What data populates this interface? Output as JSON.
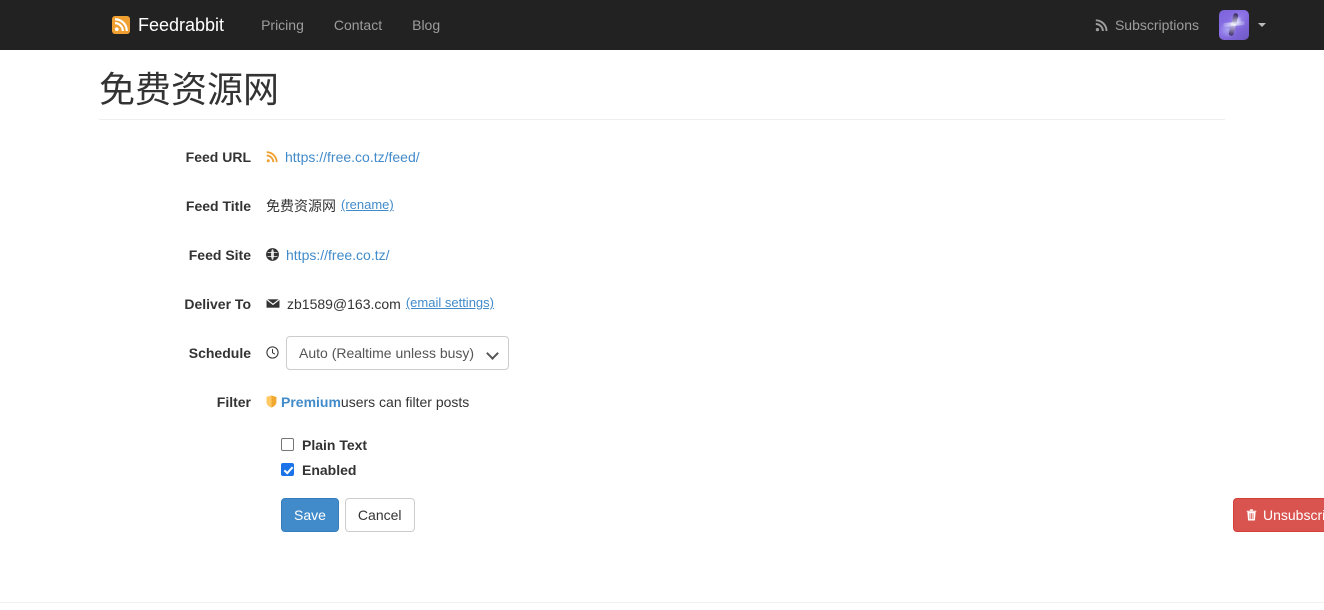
{
  "navbar": {
    "brand": {
      "label": "Feedrabbit",
      "icon": "rss-icon"
    },
    "links": [
      {
        "label": "Pricing",
        "name": "nav-link-pricing"
      },
      {
        "label": "Contact",
        "name": "nav-link-contact"
      },
      {
        "label": "Blog",
        "name": "nav-link-blog"
      }
    ],
    "subscriptions": {
      "label": "Subscriptions",
      "icon": "rss-icon"
    },
    "avatar": {
      "icon": "user-avatar",
      "caret": "caret-down-icon"
    },
    "background_color": "#222222",
    "link_color": "#9d9d9d"
  },
  "page": {
    "title": "免费资源网"
  },
  "form": {
    "feed_url": {
      "label": "Feed URL",
      "icon": "rss-icon",
      "value": "https://free.co.tz/feed/"
    },
    "feed_title": {
      "label": "Feed Title",
      "value": "免费资源网",
      "rename_link": "(rename)"
    },
    "feed_site": {
      "label": "Feed Site",
      "icon": "globe-icon",
      "value": "https://free.co.tz/"
    },
    "deliver_to": {
      "label": "Deliver To",
      "icon": "envelope-icon",
      "value": "zb1589@163.com",
      "settings_link": "(email settings)"
    },
    "schedule": {
      "label": "Schedule",
      "icon": "clock-icon",
      "selected": "Auto (Realtime unless busy)",
      "options": [
        "Auto (Realtime unless busy)"
      ]
    },
    "filter": {
      "label": "Filter",
      "icon": "shield-icon",
      "premium_label": "Premium",
      "text": " users can filter posts"
    },
    "checkboxes": [
      {
        "label": "Plain Text",
        "checked": false,
        "name": "plain-text-checkbox"
      },
      {
        "label": "Enabled",
        "checked": true,
        "name": "enabled-checkbox"
      }
    ],
    "buttons": {
      "save": "Save",
      "cancel": "Cancel",
      "unsubscribe": "Unsubscribe"
    }
  },
  "colors": {
    "primary": "#428bca",
    "danger": "#d9534f",
    "rss_orange": "#f0a030",
    "premium_gold": "#f0a830",
    "navbar_bg": "#222222"
  }
}
